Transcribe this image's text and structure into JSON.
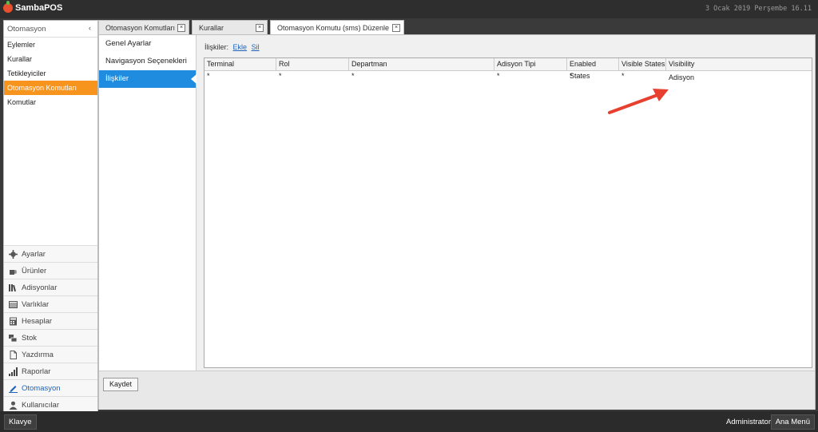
{
  "titlebar": {
    "app_name": "SambaPOS",
    "datetime": "3 Ocak 2019 Perşembe 16.11"
  },
  "sidebar": {
    "header": "Otomasyon",
    "items": [
      {
        "label": "Eylemler"
      },
      {
        "label": "Kurallar"
      },
      {
        "label": "Tetikleyiciler"
      },
      {
        "label": "Otomasyon Komutları",
        "active": true
      },
      {
        "label": "Komutlar"
      }
    ],
    "nav": [
      {
        "label": "Ayarlar",
        "icon": "gear-icon"
      },
      {
        "label": "Ürünler",
        "icon": "cup-icon"
      },
      {
        "label": "Adisyonlar",
        "icon": "books-icon"
      },
      {
        "label": "Varlıklar",
        "icon": "list-icon"
      },
      {
        "label": "Hesaplar",
        "icon": "calculator-icon"
      },
      {
        "label": "Stok",
        "icon": "boxes-icon"
      },
      {
        "label": "Yazdırma",
        "icon": "document-icon"
      },
      {
        "label": "Raporlar",
        "icon": "bar-chart-icon"
      },
      {
        "label": "Otomasyon",
        "icon": "pencil-icon",
        "active": true
      },
      {
        "label": "Kullanıcılar",
        "icon": "user-icon"
      }
    ]
  },
  "tabs": [
    {
      "label": "Otomasyon Komutları"
    },
    {
      "label": "Kurallar"
    },
    {
      "label": "Otomasyon Komutu (sms) Düzenle",
      "active": true
    }
  ],
  "editor": {
    "sections": [
      {
        "label": "Genel Ayarlar"
      },
      {
        "label": "Navigasyon Seçenekleri"
      },
      {
        "label": "İlişkiler",
        "active": true
      }
    ],
    "relations_label": "İlişkiler:",
    "add_link": "Ekle",
    "delete_link": "Sil",
    "columns": [
      "Terminal",
      "Rol",
      "Departman",
      "Adisyon Tipi",
      "Enabled States",
      "Visible States",
      "Visibility"
    ],
    "rows": [
      [
        "*",
        "*",
        "*",
        "*",
        "*",
        "*",
        "Adisyon"
      ]
    ],
    "save_label": "Kaydet"
  },
  "statusbar": {
    "keyboard_label": "Klavye",
    "user_label": "Administrator",
    "main_menu_label": "Ana Menü"
  },
  "colors": {
    "active_orange": "#f7941d",
    "selection_blue": "#1f8ce0",
    "arrow_red": "#e8402f"
  }
}
